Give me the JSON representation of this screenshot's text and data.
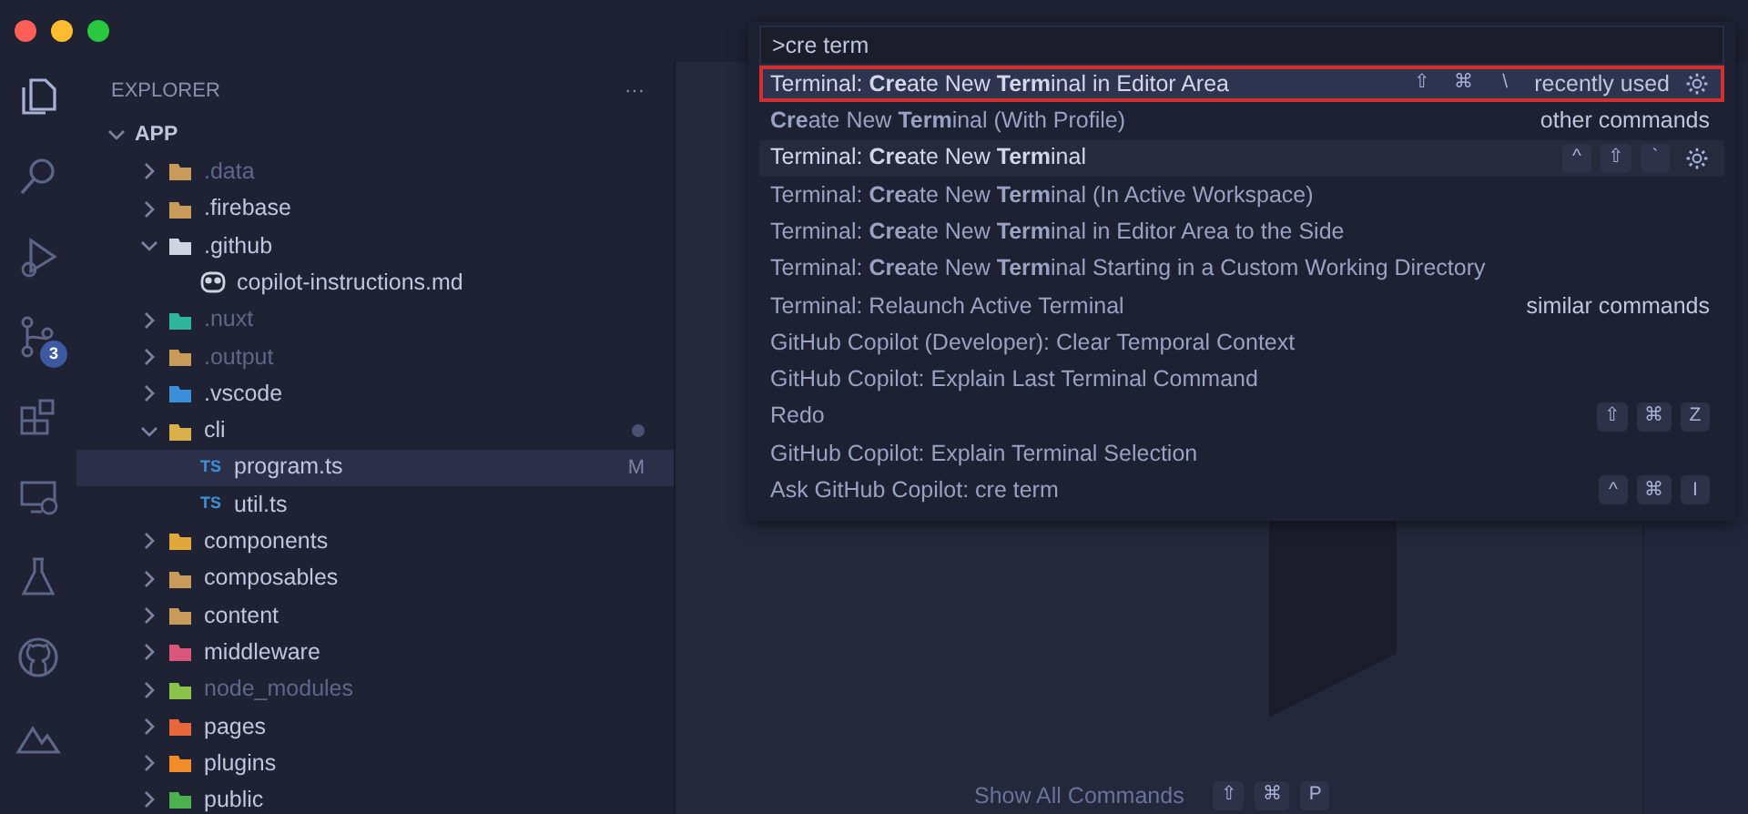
{
  "activity_bar": [
    {
      "kind": "files",
      "selected": true
    },
    {
      "kind": "search",
      "selected": false
    },
    {
      "kind": "debug",
      "selected": false
    },
    {
      "kind": "source-control",
      "selected": false,
      "badge": "3"
    },
    {
      "kind": "extensions",
      "selected": false
    },
    {
      "kind": "remote",
      "selected": false
    },
    {
      "kind": "testing",
      "selected": false
    },
    {
      "kind": "github",
      "selected": false
    },
    {
      "kind": "nuxt",
      "selected": false
    }
  ],
  "explorer": {
    "title": "EXPLORER",
    "more": "···",
    "root": {
      "name": "APP",
      "expanded": true,
      "children": [
        {
          "name": ".data",
          "kind": "folder",
          "color": "#c89b5a",
          "dimmed": true,
          "expanded": false
        },
        {
          "name": ".firebase",
          "kind": "folder",
          "color": "#c89b5a",
          "dimmed": false,
          "expanded": false
        },
        {
          "name": ".github",
          "kind": "folder",
          "color": "#d0d4e0",
          "dimmed": false,
          "expanded": true,
          "children": [
            {
              "name": "copilot-instructions.md",
              "kind": "robot",
              "dimmed": false,
              "selected": false
            }
          ]
        },
        {
          "name": ".nuxt",
          "kind": "folder",
          "color": "#2fb59a",
          "dimmed": true,
          "expanded": false
        },
        {
          "name": ".output",
          "kind": "folder",
          "color": "#c89b5a",
          "dimmed": true,
          "expanded": false
        },
        {
          "name": ".vscode",
          "kind": "folder",
          "color": "#3b8fd8",
          "dimmed": false,
          "expanded": false
        },
        {
          "name": "cli",
          "kind": "folder",
          "color": "#d8b04a",
          "dimmed": false,
          "expanded": true,
          "modified_dot": true,
          "children": [
            {
              "name": "program.ts",
              "kind": "ts",
              "type_label": "TS",
              "dimmed": false,
              "selected": true,
              "badge": "M"
            },
            {
              "name": "util.ts",
              "kind": "ts",
              "type_label": "TS",
              "dimmed": false,
              "selected": false
            }
          ]
        },
        {
          "name": "components",
          "kind": "folder",
          "color": "#e0a83a",
          "dimmed": false,
          "expanded": false
        },
        {
          "name": "composables",
          "kind": "folder",
          "color": "#c89b5a",
          "dimmed": false,
          "expanded": false
        },
        {
          "name": "content",
          "kind": "folder",
          "color": "#c89b5a",
          "dimmed": false,
          "expanded": false
        },
        {
          "name": "middleware",
          "kind": "folder",
          "color": "#d9577a",
          "dimmed": false,
          "expanded": false
        },
        {
          "name": "node_modules",
          "kind": "folder",
          "color": "#8bc34a",
          "dimmed": true,
          "expanded": false
        },
        {
          "name": "pages",
          "kind": "folder",
          "color": "#e5673a",
          "dimmed": false,
          "expanded": false
        },
        {
          "name": "plugins",
          "kind": "folder",
          "color": "#f08c2a",
          "dimmed": false,
          "expanded": false
        },
        {
          "name": "public",
          "kind": "folder",
          "color": "#4caf50",
          "dimmed": false,
          "expanded": false
        }
      ]
    }
  },
  "command_palette": {
    "query": ">cre term",
    "items": [
      {
        "label": "Terminal: **Cre**ate New **Term**inal in Editor Area",
        "selected": true,
        "hovered": false,
        "keys": [
          "⇧",
          "⌘",
          "\\"
        ],
        "group": "recently used",
        "gear": true
      },
      {
        "label": "**Cre**ate New **Term**inal (With Profile)",
        "selected": false,
        "hovered": false,
        "group": "other commands",
        "gear": false
      },
      {
        "label": "Terminal: **Cre**ate New **Term**inal",
        "selected": false,
        "hovered": true,
        "keys": [
          "^",
          "⇧",
          "`"
        ],
        "gear": true
      },
      {
        "label": "Terminal: **Cre**ate New **Term**inal (In Active Workspace)",
        "selected": false,
        "hovered": false,
        "gear": false
      },
      {
        "label": "Terminal: **Cre**ate New **Term**inal in Editor Area to the Side",
        "selected": false,
        "hovered": false,
        "gear": false
      },
      {
        "label": "Terminal: **Cre**ate New **Term**inal Starting in a Custom Working Directory",
        "selected": false,
        "hovered": false,
        "gear": false
      },
      {
        "label": "Terminal: Relaunch Active Terminal",
        "selected": false,
        "hovered": false,
        "group": "similar commands",
        "gear": false
      },
      {
        "label": "GitHub Copilot (Developer): Clear Temporal Context",
        "selected": false,
        "hovered": false,
        "gear": false
      },
      {
        "label": "GitHub Copilot: Explain Last Terminal Command",
        "selected": false,
        "hovered": false,
        "gear": false
      },
      {
        "label": "Redo",
        "selected": false,
        "hovered": false,
        "keys": [
          "⇧",
          "⌘",
          "Z"
        ],
        "gear": false
      },
      {
        "label": "GitHub Copilot: Explain Terminal Selection",
        "selected": false,
        "hovered": false,
        "gear": false
      },
      {
        "label": "Ask GitHub Copilot: cre term",
        "selected": false,
        "hovered": false,
        "keys": [
          "^",
          "⌘",
          "I"
        ],
        "gear": false
      }
    ]
  },
  "editor_hint": {
    "label": "Show All Commands",
    "keys": [
      "⇧",
      "⌘",
      "P"
    ]
  }
}
